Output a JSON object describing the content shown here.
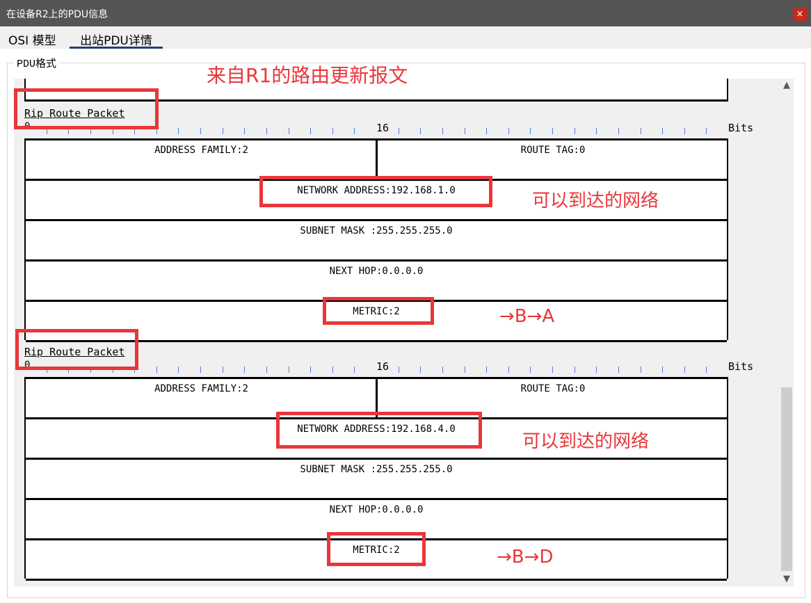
{
  "window": {
    "title": "在设备R2上的PDU信息",
    "close_label": "×"
  },
  "tabs": [
    {
      "label": "OSI 模型",
      "active": false
    },
    {
      "label": "出站PDU详情",
      "active": true
    }
  ],
  "group_label": "PDU格式",
  "annotations": {
    "top_note": "来自R1的路由更新报文",
    "reach_note_1": "可以到达的网络",
    "reach_note_2": "可以到达的网络",
    "path_note_1": "→B→A",
    "path_note_2": "→B→D"
  },
  "scale": {
    "start": "0",
    "middle": "16",
    "unit": "Bits"
  },
  "packets": [
    {
      "title": "Rip Route Packet",
      "address_family": "ADDRESS FAMILY:2",
      "route_tag": "ROUTE TAG:0",
      "network_address": "NETWORK ADDRESS:192.168.1.0",
      "subnet_mask": "SUBNET MASK :255.255.255.0",
      "next_hop": "NEXT HOP:0.0.0.0",
      "metric": "METRIC:2"
    },
    {
      "title": "Rip Route Packet",
      "address_family": "ADDRESS FAMILY:2",
      "route_tag": "ROUTE TAG:0",
      "network_address": "NETWORK ADDRESS:192.168.4.0",
      "subnet_mask": "SUBNET MASK :255.255.255.0",
      "next_hop": "NEXT HOP:0.0.0.0",
      "metric": "METRIC:2"
    }
  ],
  "colors": {
    "annotation_red": "#e8363b",
    "titlebar": "#555555",
    "tab_underline": "#1f3f74",
    "tick_blue": "#4a7fd0"
  },
  "scrollbar": {
    "up_icon": "▲",
    "down_icon": "▼"
  }
}
